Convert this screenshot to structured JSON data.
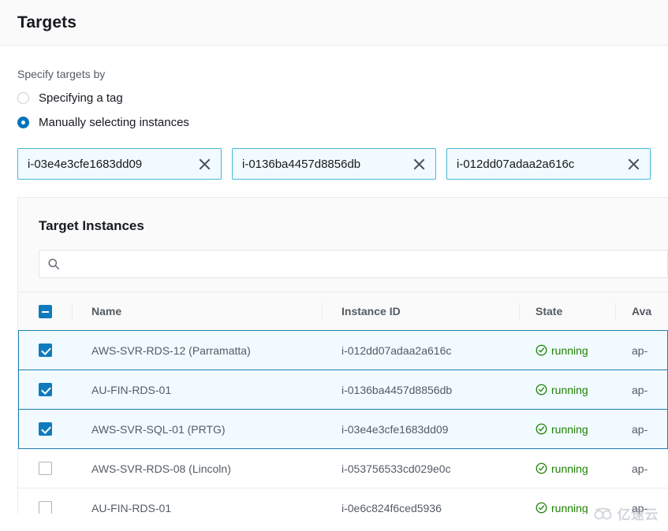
{
  "header": {
    "title": "Targets"
  },
  "form": {
    "specify_label": "Specify targets by",
    "options": [
      {
        "label": "Specifying a tag",
        "selected": false
      },
      {
        "label": "Manually selecting instances",
        "selected": true
      }
    ],
    "tokens": [
      {
        "label": "i-03e4e3cfe1683dd09",
        "dismiss": "close-icon"
      },
      {
        "label": "i-0136ba4457d8856db",
        "dismiss": "close-icon"
      },
      {
        "label": "i-012dd07adaa2a616c",
        "dismiss": "close-icon"
      }
    ]
  },
  "panel": {
    "title": "Target Instances",
    "search": {
      "icon": "search-icon",
      "value": "",
      "placeholder": ""
    },
    "table": {
      "select_all_state": "indeterminate",
      "columns": [
        {
          "key": "name",
          "label": "Name"
        },
        {
          "key": "id",
          "label": "Instance ID"
        },
        {
          "key": "state",
          "label": "State"
        },
        {
          "key": "az",
          "label": "Ava"
        }
      ],
      "rows": [
        {
          "selected": true,
          "name": "AWS-SVR-RDS-12 (Parramatta)",
          "id": "i-012dd07adaa2a616c",
          "state": "running",
          "state_icon": "check-circle-icon",
          "az": "ap-"
        },
        {
          "selected": true,
          "name": "AU-FIN-RDS-01",
          "id": "i-0136ba4457d8856db",
          "state": "running",
          "state_icon": "check-circle-icon",
          "az": "ap-"
        },
        {
          "selected": true,
          "name": "AWS-SVR-SQL-01 (PRTG)",
          "id": "i-03e4e3cfe1683dd09",
          "state": "running",
          "state_icon": "check-circle-icon",
          "az": "ap-"
        },
        {
          "selected": false,
          "name": "AWS-SVR-RDS-08 (Lincoln)",
          "id": "i-053756533cd029e0c",
          "state": "running",
          "state_icon": "check-circle-icon",
          "az": "ap-"
        },
        {
          "selected": false,
          "name": "AU-FIN-RDS-01",
          "id": "i-0e6c824f6ced5936",
          "state": "running",
          "state_icon": "check-circle-icon",
          "az": "ap-"
        }
      ]
    }
  },
  "watermark": {
    "text": "亿速云",
    "logo": "cloud-icon"
  },
  "colors": {
    "accent": "#0073bb",
    "checkbox": "#0f7bbd",
    "token_border": "#44b9d6",
    "token_bg": "#f1faff",
    "row_selected_border": "#1f7eae",
    "state_running": "#1d8102",
    "header_bg": "#fafafa",
    "divider": "#eaeded",
    "text_primary": "#16191f",
    "text_secondary": "#545b64"
  }
}
